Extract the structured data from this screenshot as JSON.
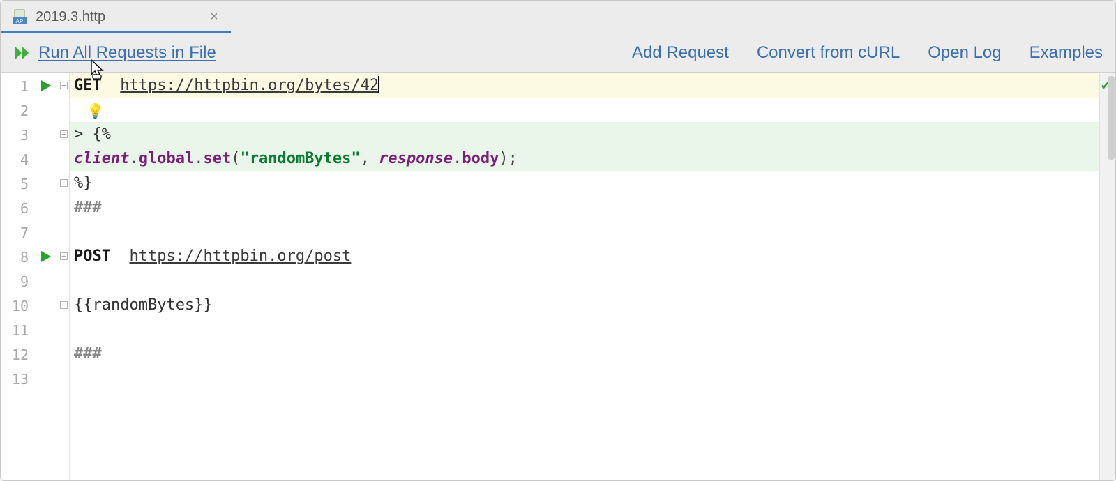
{
  "tab": {
    "filename": "2019.3.http",
    "icon_name": "api-file-icon"
  },
  "toolbar": {
    "run_all_label": "Run All Requests in File",
    "links": {
      "add_request": "Add Request",
      "convert_curl": "Convert from cURL",
      "open_log": "Open Log",
      "examples": "Examples"
    }
  },
  "editor": {
    "line_count": 13,
    "highlighted": {
      "yellow": [
        1
      ],
      "green": [
        3,
        4
      ]
    },
    "run_markers": [
      1,
      8
    ],
    "fold_markers": [
      1,
      3,
      5,
      8,
      10
    ],
    "caret_line": 1,
    "inspection_status": "ok",
    "lines": {
      "l1_method": "GET",
      "l1_url": "https://httpbin.org/bytes/42",
      "l2_bulb": "💡",
      "l3": "> {%",
      "l4_obj1": "client",
      "l4_dot1": ".",
      "l4_m1": "global",
      "l4_dot2": ".",
      "l4_m2": "set",
      "l4_p1": "(",
      "l4_str": "\"randomBytes\"",
      "l4_comma": ", ",
      "l4_obj2": "response",
      "l4_dot3": ".",
      "l4_m3": "body",
      "l4_p2": ");",
      "l5": "%}",
      "l6": "###",
      "l7": "",
      "l8_method": "POST",
      "l8_url": "https://httpbin.org/post",
      "l9": "",
      "l10": "{{randomBytes}}",
      "l11": "",
      "l12": "###",
      "l13": ""
    }
  }
}
